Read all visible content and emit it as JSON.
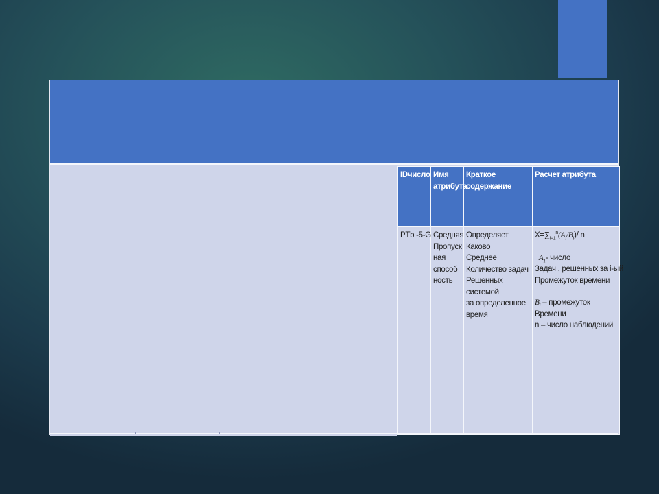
{
  "table": {
    "headers": [
      "IDчисло",
      "Имя атрибута",
      "Краткое содержание",
      "Расчет атрибута"
    ],
    "row": {
      "id": "PTb -5-G",
      "name_lines": [
        "Средняя",
        "Пропуск",
        "ная",
        "способ",
        "ность"
      ],
      "summary_lines": [
        "Определяет",
        "Каково",
        "Среднее",
        "Количество задач",
        "Решенных",
        "системой",
        "за определенное",
        "время"
      ],
      "formula": {
        "prefix": "X=",
        "sum": "∑",
        "sum_upper": "n",
        "sum_lower": "i=1",
        "expr": "(A",
        "expr_sub_a": "i",
        "expr_mid": "/B",
        "expr_sub_b": "i",
        "expr_end": ")/ n"
      },
      "a_var": "A",
      "a_sub": "1",
      "a_text": "- число",
      "calc_lines_1": [
        "Задач , решенных за i-ый",
        "Промежуток времени"
      ],
      "b_var": "B",
      "b_sub": "i",
      "b_text": " – промежуток",
      "calc_lines_2": [
        "Времени",
        " n – число наблюдений"
      ]
    }
  }
}
